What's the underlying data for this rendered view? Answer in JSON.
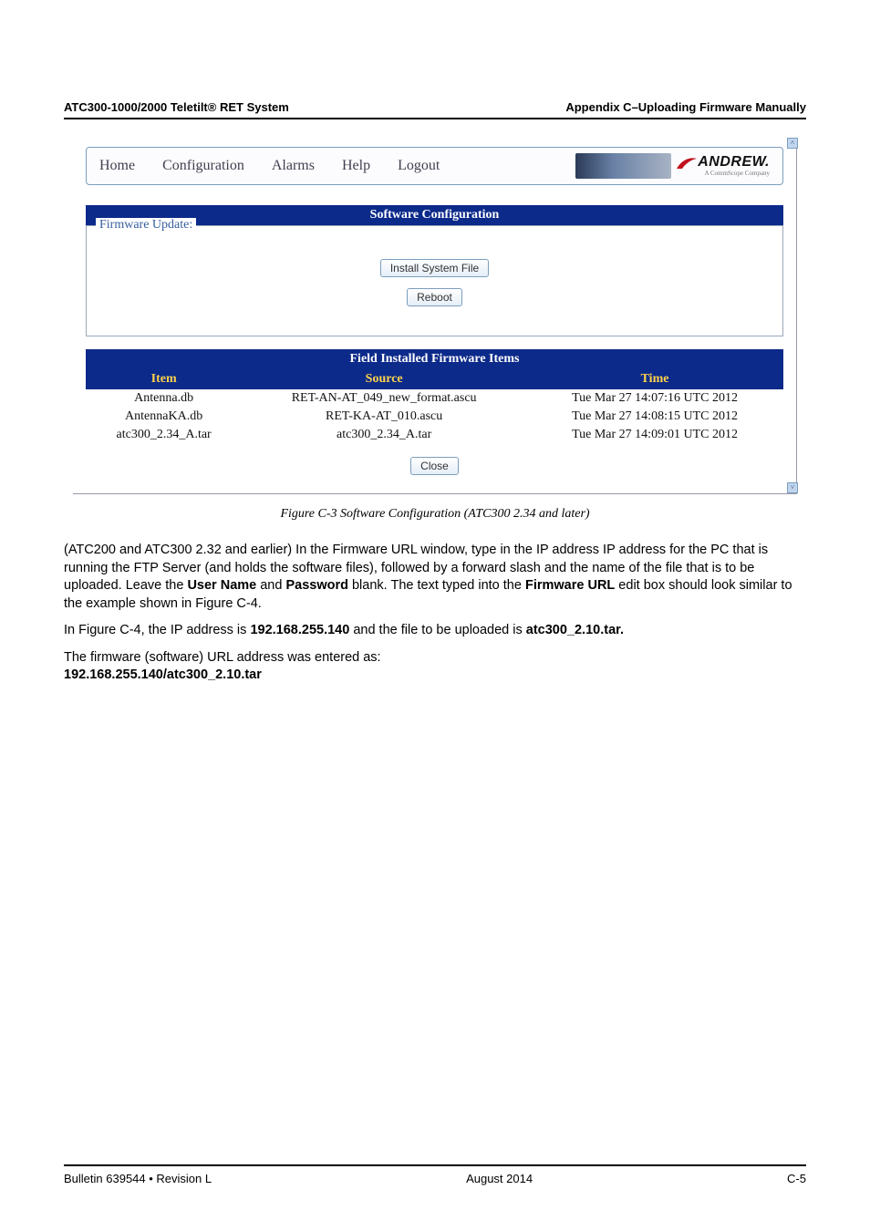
{
  "page_header": {
    "left": "ATC300-1000/2000 Teletilt® RET System",
    "right": "Appendix C–Uploading Firmware Manually"
  },
  "menubar": {
    "items": [
      "Home",
      "Configuration",
      "Alarms",
      "Help",
      "Logout"
    ],
    "brand_text": "ANDREW.",
    "brand_sub": "A CommScope Company"
  },
  "sections": {
    "software_config_title": "Software Configuration",
    "fw_legend": "Firmware Update:",
    "install_btn": "Install System File",
    "reboot_btn": "Reboot",
    "field_title": "Field Installed Firmware Items",
    "close_btn": "Close"
  },
  "table": {
    "headers": [
      "Item",
      "Source",
      "Time"
    ],
    "rows": [
      {
        "item": "Antenna.db",
        "source": "RET-AN-AT_049_new_format.ascu",
        "time": "Tue Mar 27 14:07:16 UTC 2012"
      },
      {
        "item": "AntennaKA.db",
        "source": "RET-KA-AT_010.ascu",
        "time": "Tue Mar 27 14:08:15 UTC 2012"
      },
      {
        "item": "atc300_2.34_A.tar",
        "source": "atc300_2.34_A.tar",
        "time": "Tue Mar 27 14:09:01 UTC 2012"
      }
    ]
  },
  "caption": "Figure C-3 Software Configuration (ATC300 2.34 and later)",
  "body": {
    "p1a": "(ATC200 and ATC300 2.32 and earlier) In the Firmware URL window, type in the IP address IP address for the PC that is running the FTP Server (and holds the software files), followed by a forward slash and the name of the file that is to be uploaded. Leave the ",
    "p1_user": "User Name",
    "p1_and": " and ",
    "p1_pass": "Password",
    "p1b": " blank. The text typed into the ",
    "p1_furl": "Firmware URL",
    "p1c": " edit box should look similar to the example shown in Figure C-4.",
    "p2a": "In Figure C-4, the IP address is ",
    "p2_ip": "192.168.255.140",
    "p2b": " and the file to be uploaded is ",
    "p2_file": "atc300_2.10.tar.",
    "p3a": "The firmware (software) URL address was entered as:",
    "p3b": "192.168.255.140/atc300_2.10.tar"
  },
  "footer": {
    "left": "Bulletin 639544  •  Revision L",
    "center": "August 2014",
    "right": "C-5"
  }
}
